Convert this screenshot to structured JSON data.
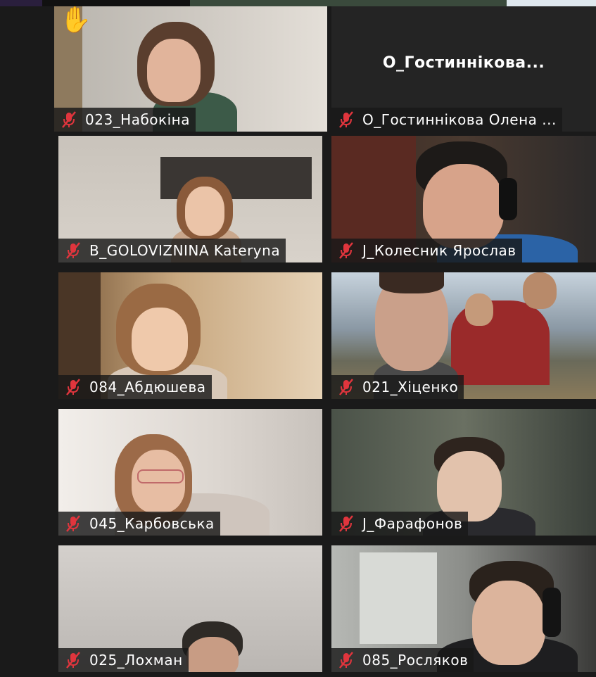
{
  "participants": [
    {
      "name": "023_Набокіна",
      "muted": true,
      "hand_raised": true,
      "active_speaker": true
    },
    {
      "name": "О_Гостиннікова Олена ...",
      "display_name": "О_Гостиннікова...",
      "muted": true,
      "video_off": true
    },
    {
      "name": "B_GOLOVIZNINA Kateryna",
      "muted": true
    },
    {
      "name": "J_Колесник Ярослав",
      "muted": true
    },
    {
      "name": "084_Абдюшева",
      "muted": true
    },
    {
      "name": "021_Хіценко",
      "muted": true
    },
    {
      "name": "045_Карбовська",
      "muted": true
    },
    {
      "name": "J_Фарафонов",
      "muted": true
    },
    {
      "name": "025_Лохман",
      "muted": true
    },
    {
      "name": "085_Росляков",
      "muted": true
    }
  ],
  "icons": {
    "muted_mic": "muted-mic-icon",
    "raised_hand": "raised-hand-icon",
    "raised_hand_glyph": "✋"
  },
  "colors": {
    "active_speaker_border": "#d4ec4b",
    "muted_icon": "#e0353d",
    "background": "#1a1a1a"
  }
}
